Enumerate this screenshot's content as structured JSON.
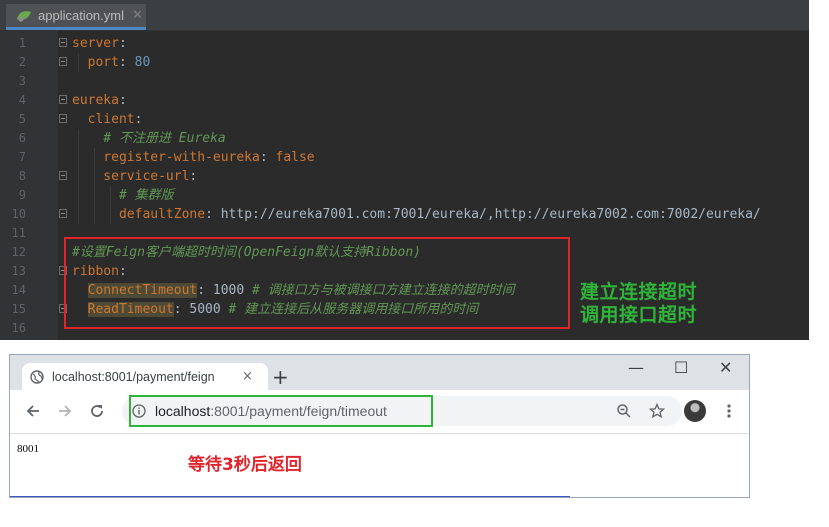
{
  "ide": {
    "tab_label": "application.yml",
    "lines": [
      {
        "num": "1",
        "segments": [
          {
            "text": "server",
            "cls": "k"
          },
          {
            "text": ":",
            "cls": "t"
          }
        ]
      },
      {
        "num": "2",
        "segments": [
          {
            "text": "  port",
            "cls": "k"
          },
          {
            "text": ": ",
            "cls": "t"
          },
          {
            "text": "80",
            "cls": "v"
          }
        ]
      },
      {
        "num": "3",
        "segments": []
      },
      {
        "num": "4",
        "segments": [
          {
            "text": "eureka",
            "cls": "k"
          },
          {
            "text": ":",
            "cls": "t"
          }
        ]
      },
      {
        "num": "5",
        "segments": [
          {
            "text": "  client",
            "cls": "k"
          },
          {
            "text": ":",
            "cls": "t"
          }
        ]
      },
      {
        "num": "6",
        "segments": [
          {
            "text": "    # 不注册进 Eureka",
            "cls": "c"
          }
        ]
      },
      {
        "num": "7",
        "segments": [
          {
            "text": "    register-with-eureka",
            "cls": "k"
          },
          {
            "text": ": ",
            "cls": "t"
          },
          {
            "text": "false",
            "cls": "k"
          }
        ]
      },
      {
        "num": "8",
        "segments": [
          {
            "text": "    service-url",
            "cls": "k"
          },
          {
            "text": ":",
            "cls": "t"
          }
        ]
      },
      {
        "num": "9",
        "segments": [
          {
            "text": "      # 集群版",
            "cls": "c"
          }
        ]
      },
      {
        "num": "10",
        "segments": [
          {
            "text": "      defaultZone",
            "cls": "k"
          },
          {
            "text": ": http://eureka7001.com:7001/eureka/,http://eureka7002.com:7002/eureka/",
            "cls": "t"
          }
        ]
      },
      {
        "num": "11",
        "segments": []
      },
      {
        "num": "12",
        "segments": [
          {
            "text": "#设置Feign客户端超时时间(OpenFeign默认支持Ribbon)",
            "cls": "c"
          }
        ]
      },
      {
        "num": "13",
        "segments": [
          {
            "text": "ribbon",
            "cls": "k"
          },
          {
            "text": ":",
            "cls": "t"
          }
        ]
      },
      {
        "num": "14",
        "segments": [
          {
            "text": "  ",
            "cls": "t"
          },
          {
            "text": "ConnectTimeout",
            "cls": "k hl"
          },
          {
            "text": ": ",
            "cls": "t"
          },
          {
            "text": "1000",
            "cls": "t"
          },
          {
            "text": " # 调接口方与被调接口方建立连接的超时时间",
            "cls": "c"
          }
        ]
      },
      {
        "num": "15",
        "segments": [
          {
            "text": "  ",
            "cls": "t"
          },
          {
            "text": "ReadTimeout",
            "cls": "k hl"
          },
          {
            "text": ": ",
            "cls": "t"
          },
          {
            "text": "5000",
            "cls": "t"
          },
          {
            "text": " # 建立连接后从服务器调用接口所用的时间",
            "cls": "c"
          }
        ]
      },
      {
        "num": "16",
        "segments": []
      }
    ],
    "fold_lines": [
      "1",
      "2",
      "4",
      "5",
      "8",
      "10",
      "13",
      "15"
    ],
    "callout_line1": "建立连接超时",
    "callout_line2": "调用接口超时"
  },
  "browser": {
    "tab_title": "localhost:8001/payment/feign",
    "tab_close": "×",
    "new_tab": "+",
    "minimize": "—",
    "maximize": "☐",
    "close_window": "✕",
    "url_host": "localhost",
    "url_path": ":8001/payment/feign/timeout",
    "page_text": "8001",
    "annotation": "等待3秒后返回"
  },
  "colors": {
    "ide_bg": "#2b2b2b",
    "highlight_red": "#e0242c",
    "highlight_green": "#2fb43a"
  }
}
